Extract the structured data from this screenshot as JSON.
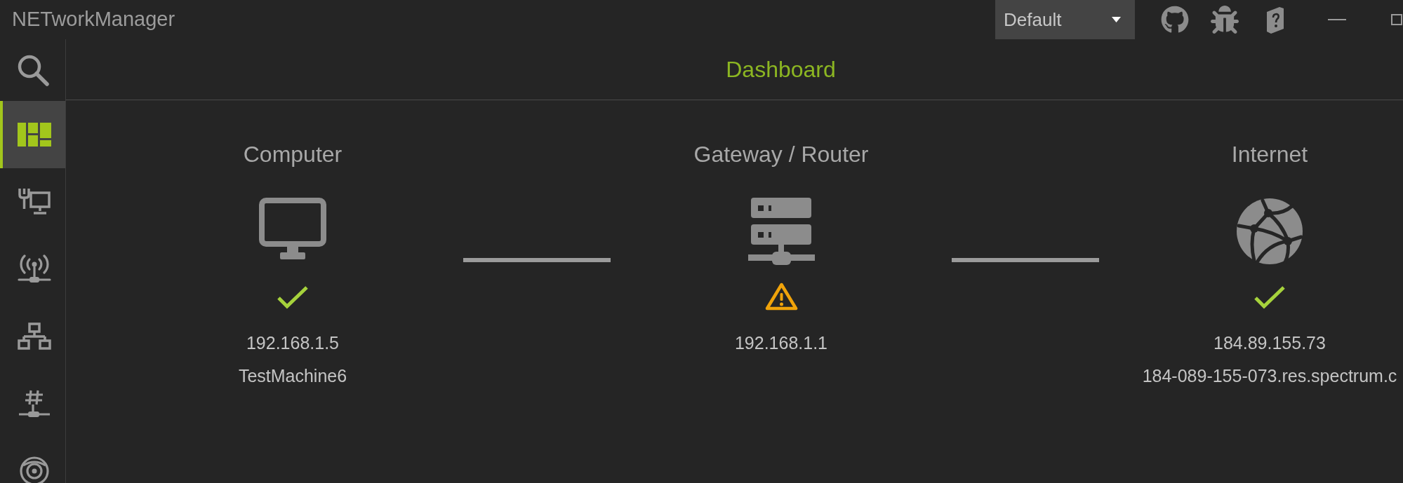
{
  "window": {
    "title": "NETworkManager",
    "profile": "Default"
  },
  "sidebar": {
    "items": [
      {
        "selected": true
      },
      {
        "selected": false
      },
      {
        "selected": false
      },
      {
        "selected": false
      },
      {
        "selected": false
      },
      {
        "selected": false
      }
    ]
  },
  "page": {
    "title": "Dashboard"
  },
  "nodes": [
    {
      "title": "Computer",
      "warning": false,
      "ip": "192.168.1.5",
      "hostname": "TestMachine6"
    },
    {
      "title": "Gateway / Router",
      "warning": true,
      "ip": "192.168.1.1"
    },
    {
      "title": "Internet",
      "warning": false,
      "ip": "184.89.155.73",
      "hostname": "184-089-155-073.res.spectrum.c"
    }
  ]
}
